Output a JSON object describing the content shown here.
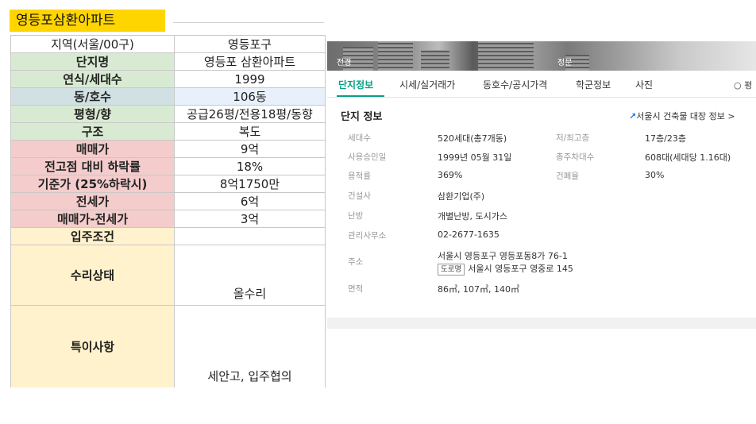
{
  "sheet": {
    "title": "영등포삼환아파트",
    "rows": [
      {
        "label": "지역(서울/00구)",
        "value": "영등포구"
      },
      {
        "label": "단지명",
        "value": "영등포 삼환아파트"
      },
      {
        "label": "연식/세대수",
        "value": "1999"
      },
      {
        "label": "동/호수",
        "value": "106동"
      },
      {
        "label": "평형/향",
        "value": "공급26평/전용18평/동향"
      },
      {
        "label": "구조",
        "value": "복도"
      },
      {
        "label": "매매가",
        "value": "9억"
      },
      {
        "label": "전고점 대비 하락률",
        "value": "18%"
      },
      {
        "label": "기준가 (25%하락시)",
        "value": "8억1750만"
      },
      {
        "label": "전세가",
        "value": "6억"
      },
      {
        "label": "매매가-전세가",
        "value": "3억"
      },
      {
        "label": "입주조건",
        "value": ""
      },
      {
        "label": "수리상태",
        "value": "올수리"
      },
      {
        "label": "특이사항",
        "value": "세안고, 입주협의"
      }
    ]
  },
  "panel": {
    "photo_labels": [
      "전경",
      "정문"
    ],
    "tabs": [
      "단지정보",
      "시세/실거래가",
      "동호수/공시가격",
      "학군정보",
      "사진"
    ],
    "tab_more": "○ 평",
    "info_title": "단지 정보",
    "seoul_link": "서울시 건축물 대장 정보 >",
    "info": {
      "households_label": "세대수",
      "households": "520세대(총7개동)",
      "floors_label": "저/최고층",
      "floors": "17층/23층",
      "approval_label": "사용승인일",
      "approval": "1999년 05월 31일",
      "parking_label": "총주차대수",
      "parking": "608대(세대당 1.16대)",
      "far_label": "용적률",
      "far": "369%",
      "bcr_label": "건폐율",
      "bcr": "30%",
      "builder_label": "건설사",
      "builder": "삼환기업(주)",
      "heating_label": "난방",
      "heating": "개별난방, 도시가스",
      "office_label": "관리사무소",
      "office": "02-2677-1635",
      "address_label": "주소",
      "address": "서울시 영등포구 영등포동8가 76-1",
      "road_tag": "도로명",
      "road_address": "서울시 영등포구 영중로 145",
      "area_label": "면적",
      "area": "86㎡, 107㎡, 140㎡"
    }
  },
  "colors": {
    "title_yellow": "#ffd500",
    "green": "#d9ead3",
    "teal": "#d0e0e3",
    "pink": "#f4cccc",
    "yellow": "#fff2cc",
    "accent": "#0a9e86"
  }
}
